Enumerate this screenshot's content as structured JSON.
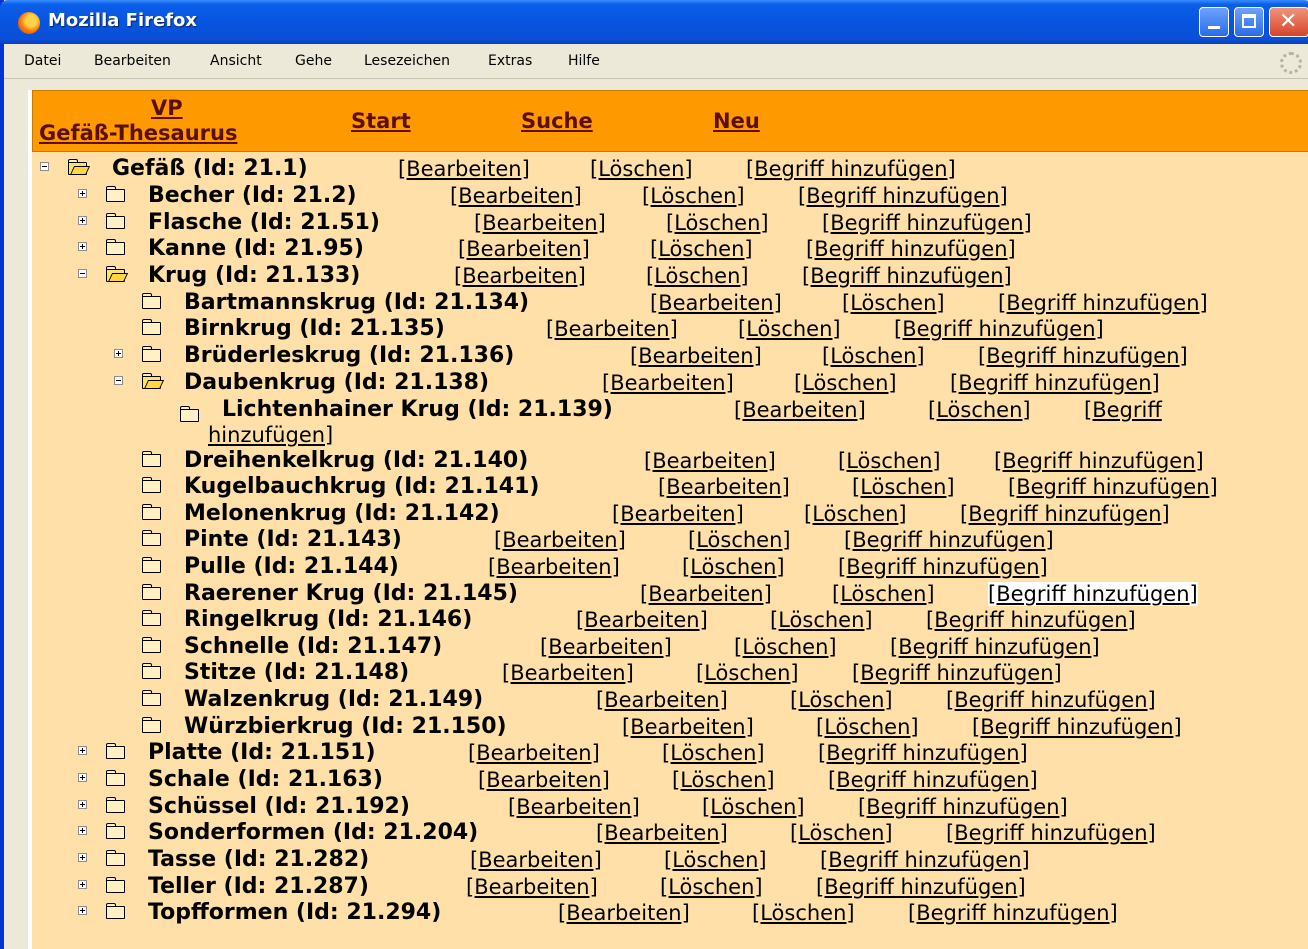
{
  "window": {
    "title": "Mozilla Firefox"
  },
  "menu": [
    "Datei",
    "Bearbeiten",
    "Ansicht",
    "Gehe",
    "Lesezeichen",
    "Extras",
    "Hilfe"
  ],
  "nav": {
    "vp": "VP",
    "thesaurus": "Gefäß-Thesaurus",
    "start": "Start",
    "suche": "Suche",
    "neu": "Neu"
  },
  "actions": {
    "edit": "[Bearbeiten]",
    "delete": "[Löschen]",
    "add": "[Begriff hinzufügen]",
    "add_part1": "[Begriff",
    "add_part2": "hinzufügen]"
  },
  "tree": [
    {
      "label": "Gefäß (Id: 21.1)",
      "toggle": "minus",
      "folder": "open"
    },
    {
      "label": "Becher (Id: 21.2)",
      "toggle": "plus",
      "folder": "closed"
    },
    {
      "label": "Flasche (Id: 21.51)",
      "toggle": "plus",
      "folder": "closed"
    },
    {
      "label": "Kanne (Id: 21.95)",
      "toggle": "plus",
      "folder": "closed"
    },
    {
      "label": "Krug (Id: 21.133)",
      "toggle": "minus",
      "folder": "open"
    },
    {
      "label": "Bartmannskrug (Id: 21.134)",
      "toggle": "none",
      "folder": "closed"
    },
    {
      "label": "Birnkrug (Id: 21.135)",
      "toggle": "none",
      "folder": "closed"
    },
    {
      "label": "Brüderleskrug (Id: 21.136)",
      "toggle": "plus",
      "folder": "closed"
    },
    {
      "label": "Daubenkrug (Id: 21.138)",
      "toggle": "minus",
      "folder": "open"
    },
    {
      "label": "Lichtenhainer Krug (Id: 21.139)",
      "toggle": "none",
      "folder": "closed"
    },
    {
      "label": "Dreihenkelkrug (Id: 21.140)",
      "toggle": "none",
      "folder": "closed"
    },
    {
      "label": "Kugelbauchkrug (Id: 21.141)",
      "toggle": "none",
      "folder": "closed"
    },
    {
      "label": "Melonenkrug (Id: 21.142)",
      "toggle": "none",
      "folder": "closed"
    },
    {
      "label": "Pinte (Id: 21.143)",
      "toggle": "none",
      "folder": "closed"
    },
    {
      "label": "Pulle (Id: 21.144)",
      "toggle": "none",
      "folder": "closed"
    },
    {
      "label": "Raerener Krug (Id: 21.145)",
      "toggle": "none",
      "folder": "closed"
    },
    {
      "label": "Ringelkrug (Id: 21.146)",
      "toggle": "none",
      "folder": "closed"
    },
    {
      "label": "Schnelle (Id: 21.147)",
      "toggle": "none",
      "folder": "closed"
    },
    {
      "label": "Stitze (Id: 21.148)",
      "toggle": "none",
      "folder": "closed"
    },
    {
      "label": "Walzenkrug (Id: 21.149)",
      "toggle": "none",
      "folder": "closed"
    },
    {
      "label": "Würzbierkrug (Id: 21.150)",
      "toggle": "none",
      "folder": "closed"
    },
    {
      "label": "Platte (Id: 21.151)",
      "toggle": "plus",
      "folder": "closed"
    },
    {
      "label": "Schale (Id: 21.163)",
      "toggle": "plus",
      "folder": "closed"
    },
    {
      "label": "Schüssel (Id: 21.192)",
      "toggle": "plus",
      "folder": "closed"
    },
    {
      "label": "Sonderformen (Id: 21.204)",
      "toggle": "plus",
      "folder": "closed"
    },
    {
      "label": "Tasse (Id: 21.282)",
      "toggle": "plus",
      "folder": "closed"
    },
    {
      "label": "Teller (Id: 21.287)",
      "toggle": "plus",
      "folder": "closed"
    },
    {
      "label": "Topfformen (Id: 21.294)",
      "toggle": "plus",
      "folder": "closed"
    }
  ]
}
